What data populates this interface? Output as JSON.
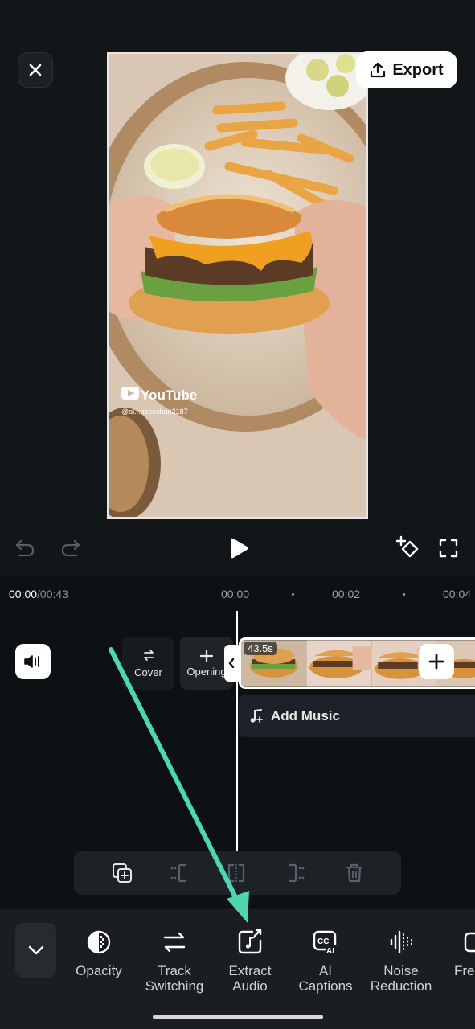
{
  "header": {
    "export_label": "Export"
  },
  "preview": {
    "watermark_brand": "YouTube",
    "watermark_handle": "@al...azeeshan2187"
  },
  "timeline": {
    "current_time": "00:00",
    "total_time": "/00:43",
    "ruler": [
      "00:00",
      "00:02",
      "00:04"
    ],
    "cover_label": "Cover",
    "opening_label": "Opening",
    "clip_duration": "43.5s",
    "add_music_label": "Add Music"
  },
  "toolbar": {
    "tools": [
      {
        "label": "Opacity",
        "icon": "opacity-icon"
      },
      {
        "label": "Track\nSwitching",
        "icon": "track-switching-icon"
      },
      {
        "label": "Extract\nAudio",
        "icon": "extract-audio-icon"
      },
      {
        "label": "AI\nCaptions",
        "icon": "ai-captions-icon"
      },
      {
        "label": "Noise\nReduction",
        "icon": "noise-reduction-icon"
      },
      {
        "label": "Fre",
        "icon": "freeze-icon"
      }
    ]
  },
  "colors": {
    "background": "#121619",
    "annotation_arrow": "#4fd6b0"
  }
}
